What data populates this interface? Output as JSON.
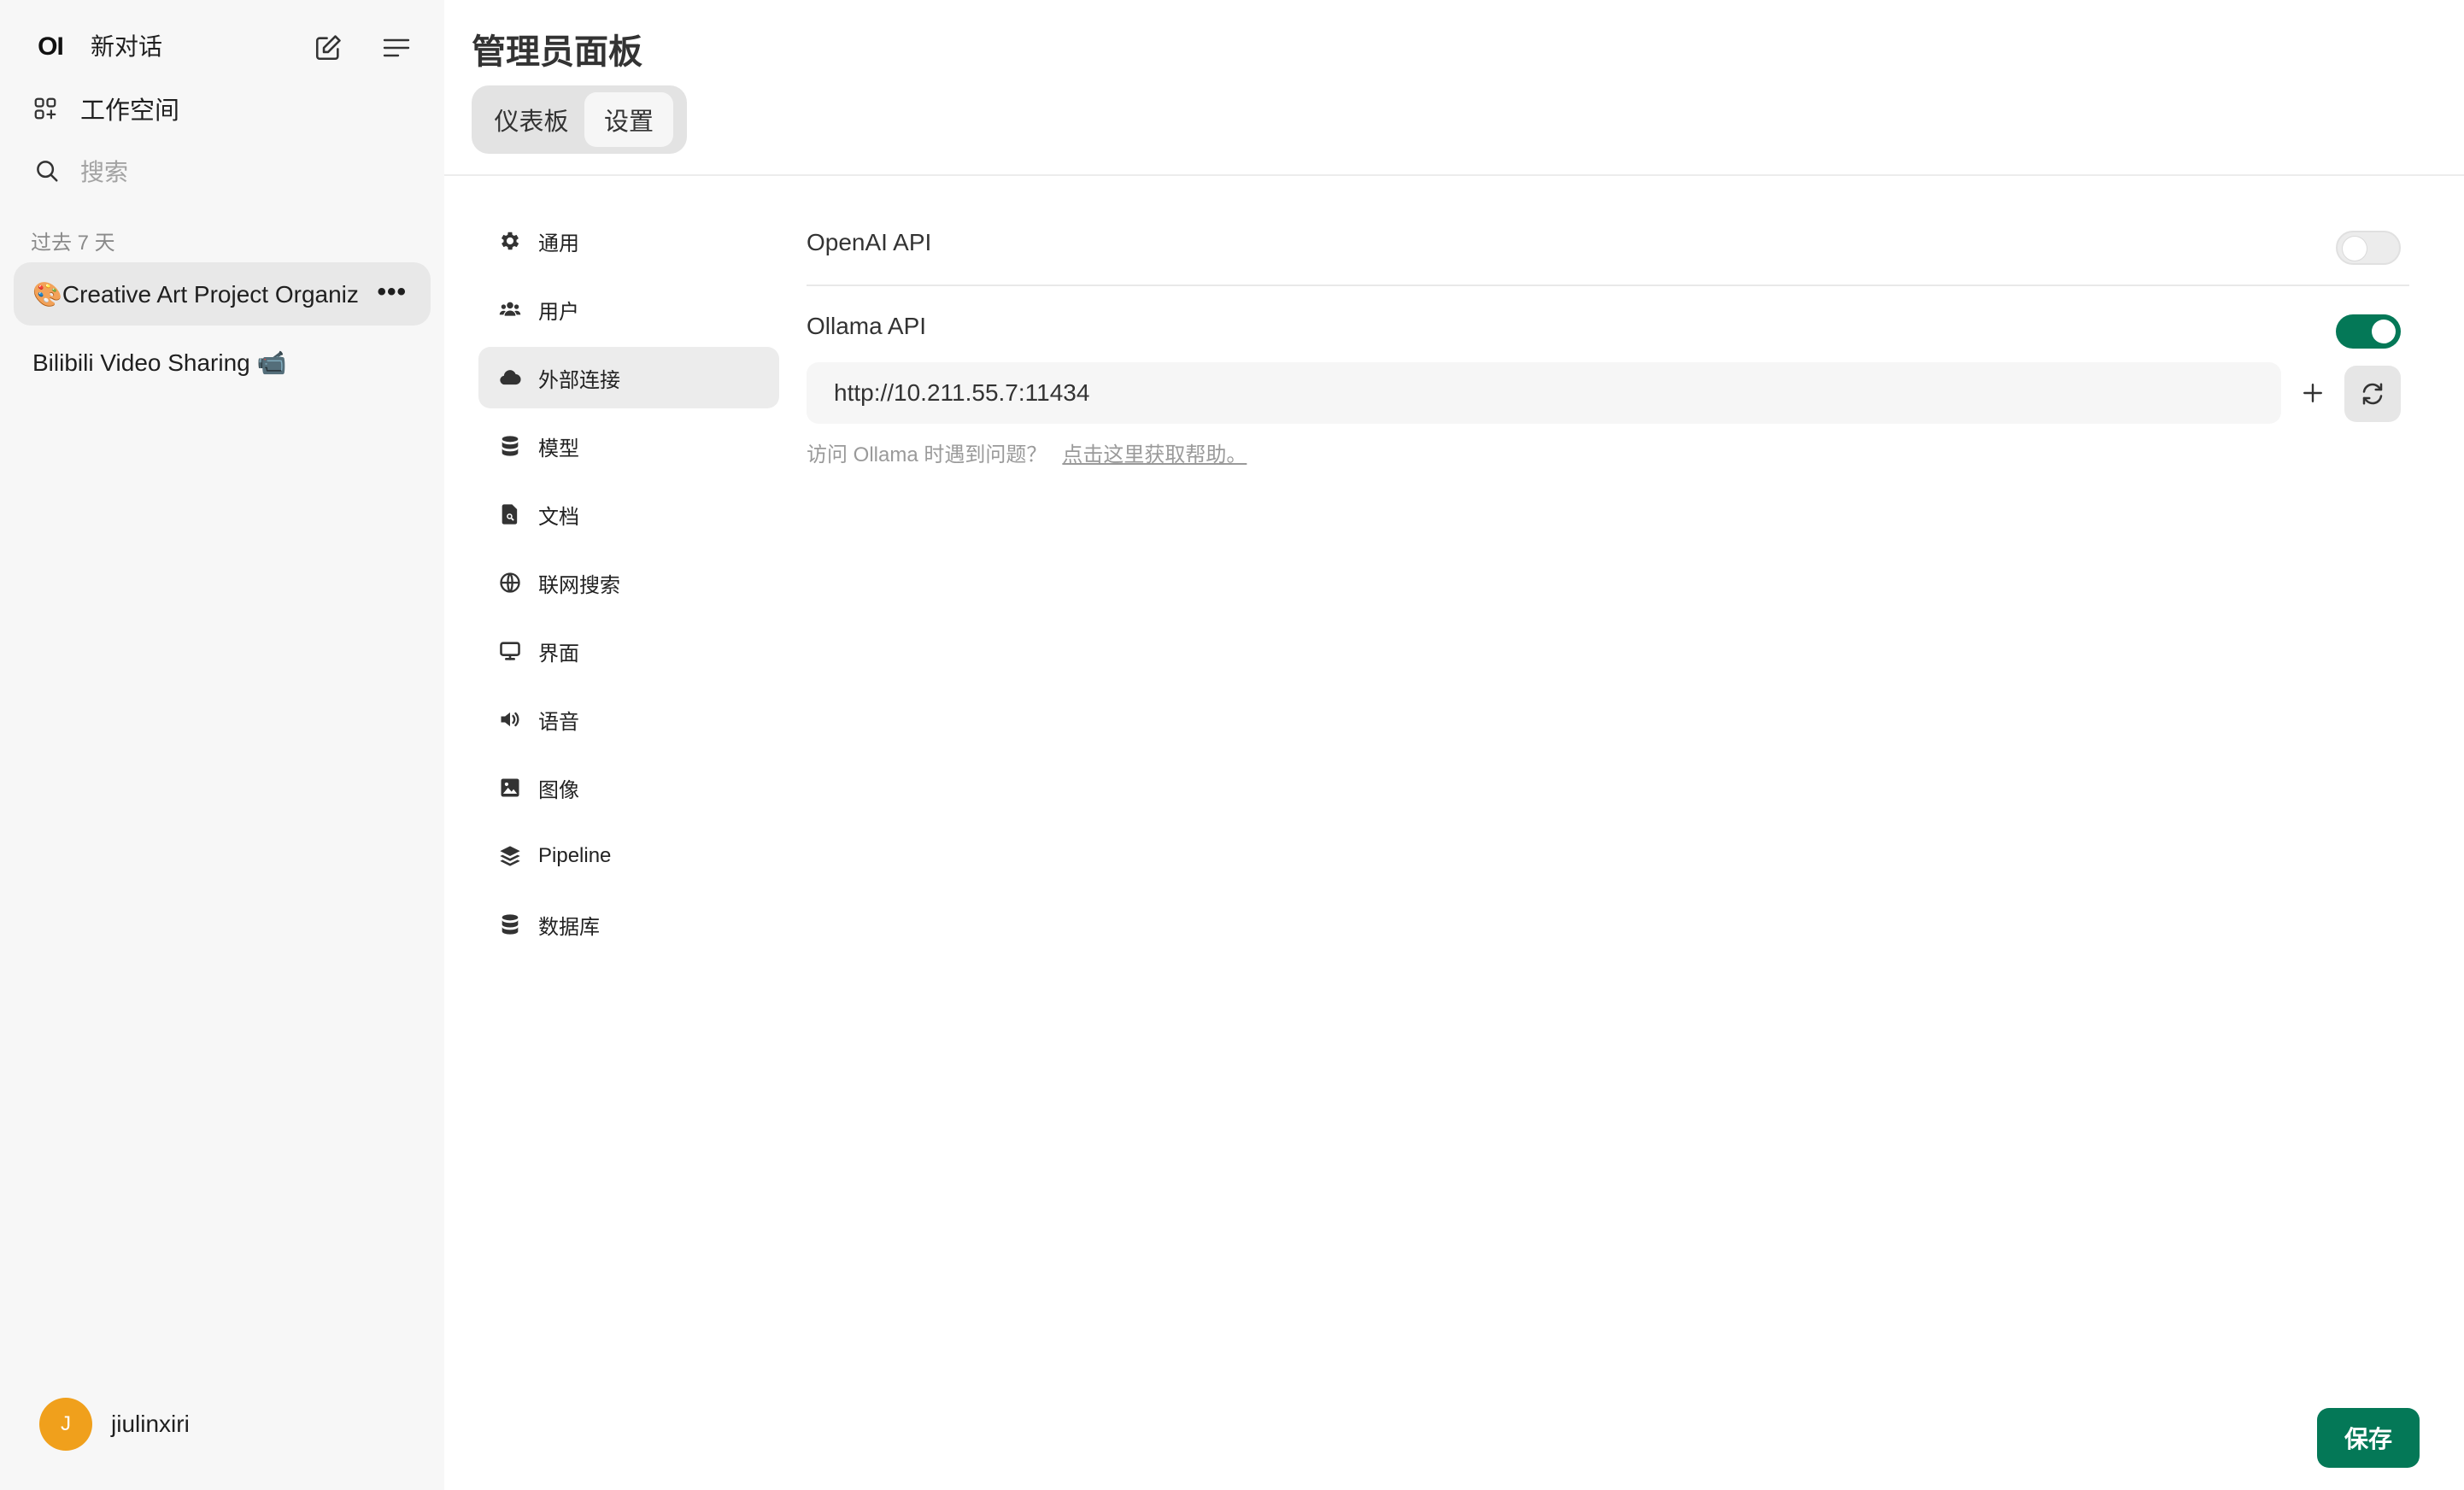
{
  "sidebar": {
    "logo": "OI",
    "new_chat": "新对话",
    "workspace": "工作空间",
    "search_placeholder": "搜索",
    "section_label": "过去 7 天",
    "chats": [
      {
        "title": "🎨Creative Art Project Organiz"
      },
      {
        "title": "Bilibili Video Sharing 📹"
      }
    ],
    "user": {
      "initial": "J",
      "name": "jiulinxiri",
      "avatar_color": "#f0a01c"
    }
  },
  "header": {
    "title": "管理员面板",
    "tabs": [
      {
        "label": "仪表板"
      },
      {
        "label": "设置"
      }
    ],
    "active_tab": "设置"
  },
  "settings_nav": {
    "items": [
      {
        "label": "通用",
        "icon": "gear-icon"
      },
      {
        "label": "用户",
        "icon": "users-icon"
      },
      {
        "label": "外部连接",
        "icon": "cloud-icon"
      },
      {
        "label": "模型",
        "icon": "database-icon"
      },
      {
        "label": "文档",
        "icon": "document-search-icon"
      },
      {
        "label": "联网搜索",
        "icon": "globe-icon"
      },
      {
        "label": "界面",
        "icon": "monitor-icon"
      },
      {
        "label": "语音",
        "icon": "speaker-icon"
      },
      {
        "label": "图像",
        "icon": "image-icon"
      },
      {
        "label": "Pipeline",
        "icon": "layers-icon"
      },
      {
        "label": "数据库",
        "icon": "database-icon"
      }
    ],
    "active": "外部连接"
  },
  "connections": {
    "openai": {
      "label": "OpenAI API",
      "enabled": false
    },
    "ollama": {
      "label": "Ollama API",
      "enabled": true,
      "url": "http://10.211.55.7:11434",
      "help_text": "访问 Ollama 时遇到问题？",
      "help_link": "点击这里获取帮助。"
    }
  },
  "actions": {
    "save_label": "保存"
  },
  "colors": {
    "accent": "#047857",
    "avatar": "#f0a01c"
  }
}
